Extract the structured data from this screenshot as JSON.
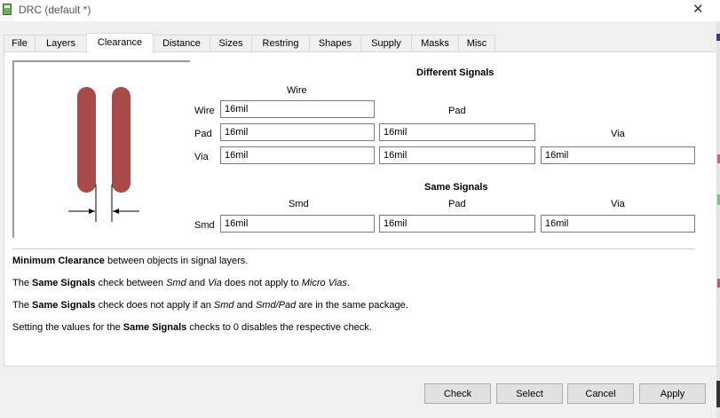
{
  "window": {
    "title": "DRC (default *)"
  },
  "tabs": [
    {
      "label": "File"
    },
    {
      "label": "Layers"
    },
    {
      "label": "Clearance"
    },
    {
      "label": "Distance"
    },
    {
      "label": "Sizes"
    },
    {
      "label": "Restring"
    },
    {
      "label": "Shapes"
    },
    {
      "label": "Supply"
    },
    {
      "label": "Masks"
    },
    {
      "label": "Misc"
    }
  ],
  "active_tab": "Clearance",
  "different_signals": {
    "heading": "Different Signals",
    "col_wire": "Wire",
    "col_pad": "Pad",
    "col_via": "Via",
    "row_wire": "Wire",
    "row_pad": "Pad",
    "row_via": "Via",
    "wire_wire": "16mil",
    "pad_wire": "16mil",
    "pad_pad": "16mil",
    "via_wire": "16mil",
    "via_pad": "16mil",
    "via_via": "16mil"
  },
  "same_signals": {
    "heading": "Same Signals",
    "col_smd": "Smd",
    "col_pad": "Pad",
    "col_via": "Via",
    "row_smd": "Smd",
    "smd_smd": "16mil",
    "smd_pad": "16mil",
    "smd_via": "16mil"
  },
  "description": {
    "line1_bold": "Minimum Clearance",
    "line1_rest": " between objects in signal layers.",
    "line2_a": "The ",
    "line2_bold": "Same Signals",
    "line2_b": " check between ",
    "line2_i1": "Smd",
    "line2_c": " and ",
    "line2_i2": "Via",
    "line2_d": " does not apply to ",
    "line2_i3": "Micro Vias",
    "line2_e": ".",
    "line3_a": "The ",
    "line3_bold": "Same Signals",
    "line3_b": " check does not apply if an ",
    "line3_i1": "Smd",
    "line3_c": " and ",
    "line3_i2": "Smd/Pad",
    "line3_d": " are in the same package.",
    "line4_a": "Setting the values for the ",
    "line4_bold": "Same Signals",
    "line4_b": " checks to 0 disables the respective check."
  },
  "buttons": {
    "check": "Check",
    "select": "Select",
    "cancel": "Cancel",
    "apply": "Apply"
  },
  "colors": {
    "wire": "#a84a4a",
    "panel": "#ffffff",
    "window": "#f0f0f0"
  },
  "icons": {
    "app": "eagle-app-icon",
    "close": "close-icon"
  }
}
